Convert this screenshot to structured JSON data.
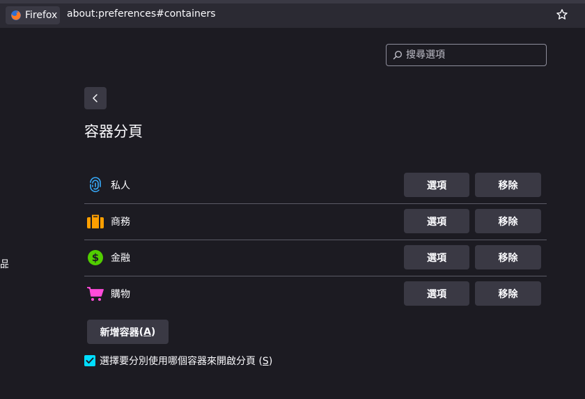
{
  "browser": {
    "identity_label": "Firefox",
    "url": "about:preferences#containers"
  },
  "search": {
    "placeholder": "搜尋選項"
  },
  "page": {
    "title": "容器分頁",
    "side_fragment": "品"
  },
  "containers": [
    {
      "name": "私人",
      "icon": "fingerprint-icon",
      "color": "#37adff",
      "options_label": "選項",
      "remove_label": "移除"
    },
    {
      "name": "商務",
      "icon": "briefcase-icon",
      "color": "#ff9f00",
      "options_label": "選項",
      "remove_label": "移除"
    },
    {
      "name": "金融",
      "icon": "dollar-icon",
      "color": "#51cd00",
      "options_label": "選項",
      "remove_label": "移除"
    },
    {
      "name": "購物",
      "icon": "cart-icon",
      "color": "#ff4bda",
      "options_label": "選項",
      "remove_label": "移除"
    }
  ],
  "add_button": {
    "label": "新增容器",
    "accesskey_open": " (",
    "accesskey": "A",
    "accesskey_close": ")"
  },
  "checkbox": {
    "label": "選擇要分別使用哪個容器來開啟分頁",
    "accesskey_open": " (",
    "accesskey": "S",
    "accesskey_close": ")",
    "checked": true
  },
  "colors": {
    "background": "#1c1b22",
    "button": "#3a3944",
    "accent": "#00ddff"
  }
}
